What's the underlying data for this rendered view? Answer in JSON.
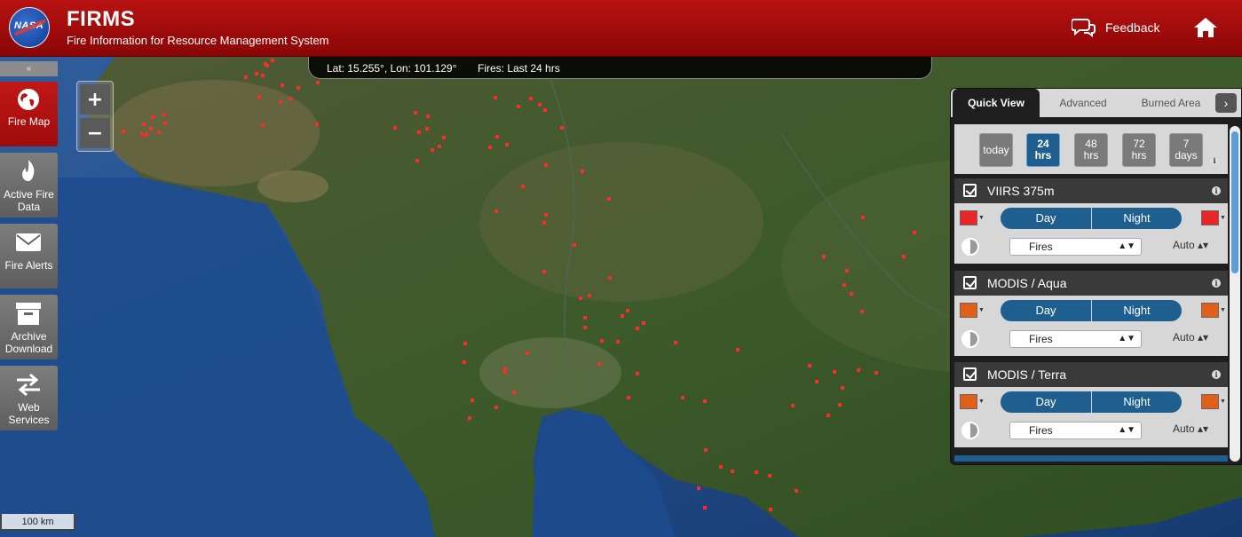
{
  "header": {
    "logo_text": "NASA",
    "title": "FIRMS",
    "subtitle": "Fire Information for Resource Management System",
    "feedback_label": "Feedback"
  },
  "status": {
    "coords": "Lat: 15.255°, Lon: 101.129°",
    "fires_range": "Fires: Last 24 hrs"
  },
  "nav": {
    "collapse_symbol": "«",
    "items": [
      {
        "label1": "Fire Map",
        "label2": "",
        "icon": "globe-icon"
      },
      {
        "label1": "Active Fire",
        "label2": "Data",
        "icon": "flame-icon"
      },
      {
        "label1": "Fire Alerts",
        "label2": "",
        "icon": "envelope-icon"
      },
      {
        "label1": "Archive",
        "label2": "Download",
        "icon": "archive-box-icon"
      },
      {
        "label1": "Web",
        "label2": "Services",
        "icon": "swap-arrows-icon"
      }
    ]
  },
  "zoom": {
    "in": "+",
    "out": "−"
  },
  "scale": {
    "label": "100 km"
  },
  "panel": {
    "tabs": [
      "Quick View",
      "Advanced",
      "Burned Area"
    ],
    "tab_arrow": "›",
    "time_buttons": [
      {
        "l1": "today",
        "l2": ""
      },
      {
        "l1": "24",
        "l2": "hrs"
      },
      {
        "l1": "48",
        "l2": "hrs"
      },
      {
        "l1": "72",
        "l2": "hrs"
      },
      {
        "l1": "7",
        "l2": "days"
      }
    ],
    "active_time": "24 hrs",
    "info_symbol": "i",
    "layers": [
      {
        "name": "VIIRS 375m",
        "day": "Day",
        "night": "Night",
        "type": "Fires",
        "auto": "Auto",
        "color": "#e8262a",
        "checked": true
      },
      {
        "name": "MODIS / Aqua",
        "day": "Day",
        "night": "Night",
        "type": "Fires",
        "auto": "Auto",
        "color": "#e0601a",
        "checked": true
      },
      {
        "name": "MODIS / Terra",
        "day": "Day",
        "night": "Night",
        "type": "Fires",
        "auto": "Auto",
        "color": "#e0601a",
        "checked": true
      }
    ],
    "select_arrow": "▲▼",
    "auto_arrow": "▴▾"
  },
  "colors": {
    "header_red": "#a80c0c",
    "active_blue": "#1f5f8f",
    "fire_red": "#ff2a2a"
  }
}
